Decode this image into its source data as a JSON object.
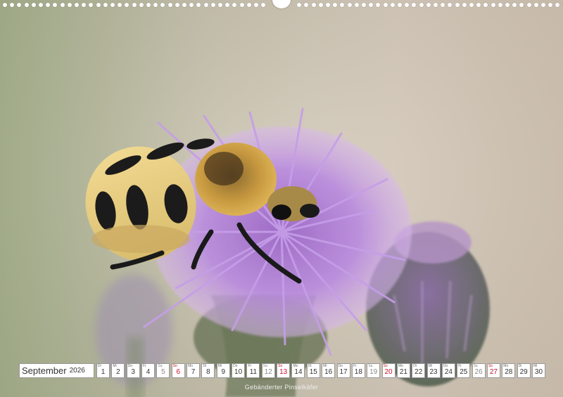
{
  "calendar": {
    "month": "September",
    "year": "2026",
    "days": [
      {
        "wd": "Di",
        "d": "1",
        "type": "weekday"
      },
      {
        "wd": "Mi",
        "d": "2",
        "type": "weekday"
      },
      {
        "wd": "Do",
        "d": "3",
        "type": "weekday"
      },
      {
        "wd": "Fr",
        "d": "4",
        "type": "weekday"
      },
      {
        "wd": "Sa",
        "d": "5",
        "type": "sat"
      },
      {
        "wd": "So",
        "d": "6",
        "type": "sun"
      },
      {
        "wd": "Mo",
        "d": "7",
        "type": "weekday"
      },
      {
        "wd": "Di",
        "d": "8",
        "type": "weekday"
      },
      {
        "wd": "Mi",
        "d": "9",
        "type": "weekday"
      },
      {
        "wd": "Do",
        "d": "10",
        "type": "weekday"
      },
      {
        "wd": "Fr",
        "d": "11",
        "type": "weekday"
      },
      {
        "wd": "Sa",
        "d": "12",
        "type": "sat"
      },
      {
        "wd": "So",
        "d": "13",
        "type": "sun"
      },
      {
        "wd": "Mo",
        "d": "14",
        "type": "weekday"
      },
      {
        "wd": "Di",
        "d": "15",
        "type": "weekday"
      },
      {
        "wd": "Mi",
        "d": "16",
        "type": "weekday"
      },
      {
        "wd": "Do",
        "d": "17",
        "type": "weekday"
      },
      {
        "wd": "Fr",
        "d": "18",
        "type": "weekday"
      },
      {
        "wd": "Sa",
        "d": "19",
        "type": "sat"
      },
      {
        "wd": "So",
        "d": "20",
        "type": "sun"
      },
      {
        "wd": "Mo",
        "d": "21",
        "type": "weekday"
      },
      {
        "wd": "Di",
        "d": "22",
        "type": "weekday"
      },
      {
        "wd": "Mi",
        "d": "23",
        "type": "weekday"
      },
      {
        "wd": "Do",
        "d": "24",
        "type": "weekday"
      },
      {
        "wd": "Fr",
        "d": "25",
        "type": "weekday"
      },
      {
        "wd": "Sa",
        "d": "26",
        "type": "sat"
      },
      {
        "wd": "So",
        "d": "27",
        "type": "sun"
      },
      {
        "wd": "Mo",
        "d": "28",
        "type": "weekday"
      },
      {
        "wd": "Di",
        "d": "29",
        "type": "weekday"
      },
      {
        "wd": "Mi",
        "d": "30",
        "type": "weekday"
      }
    ]
  },
  "caption": "Gebänderter Pinselkäfer",
  "colors": {
    "sunday": "#c8102e",
    "background_green": "#a8b48c",
    "background_beige": "#d8ccbc",
    "thistle_purple": "#b48ad8",
    "beetle_yellow": "#e0c070",
    "beetle_black": "#1a1a1a"
  }
}
